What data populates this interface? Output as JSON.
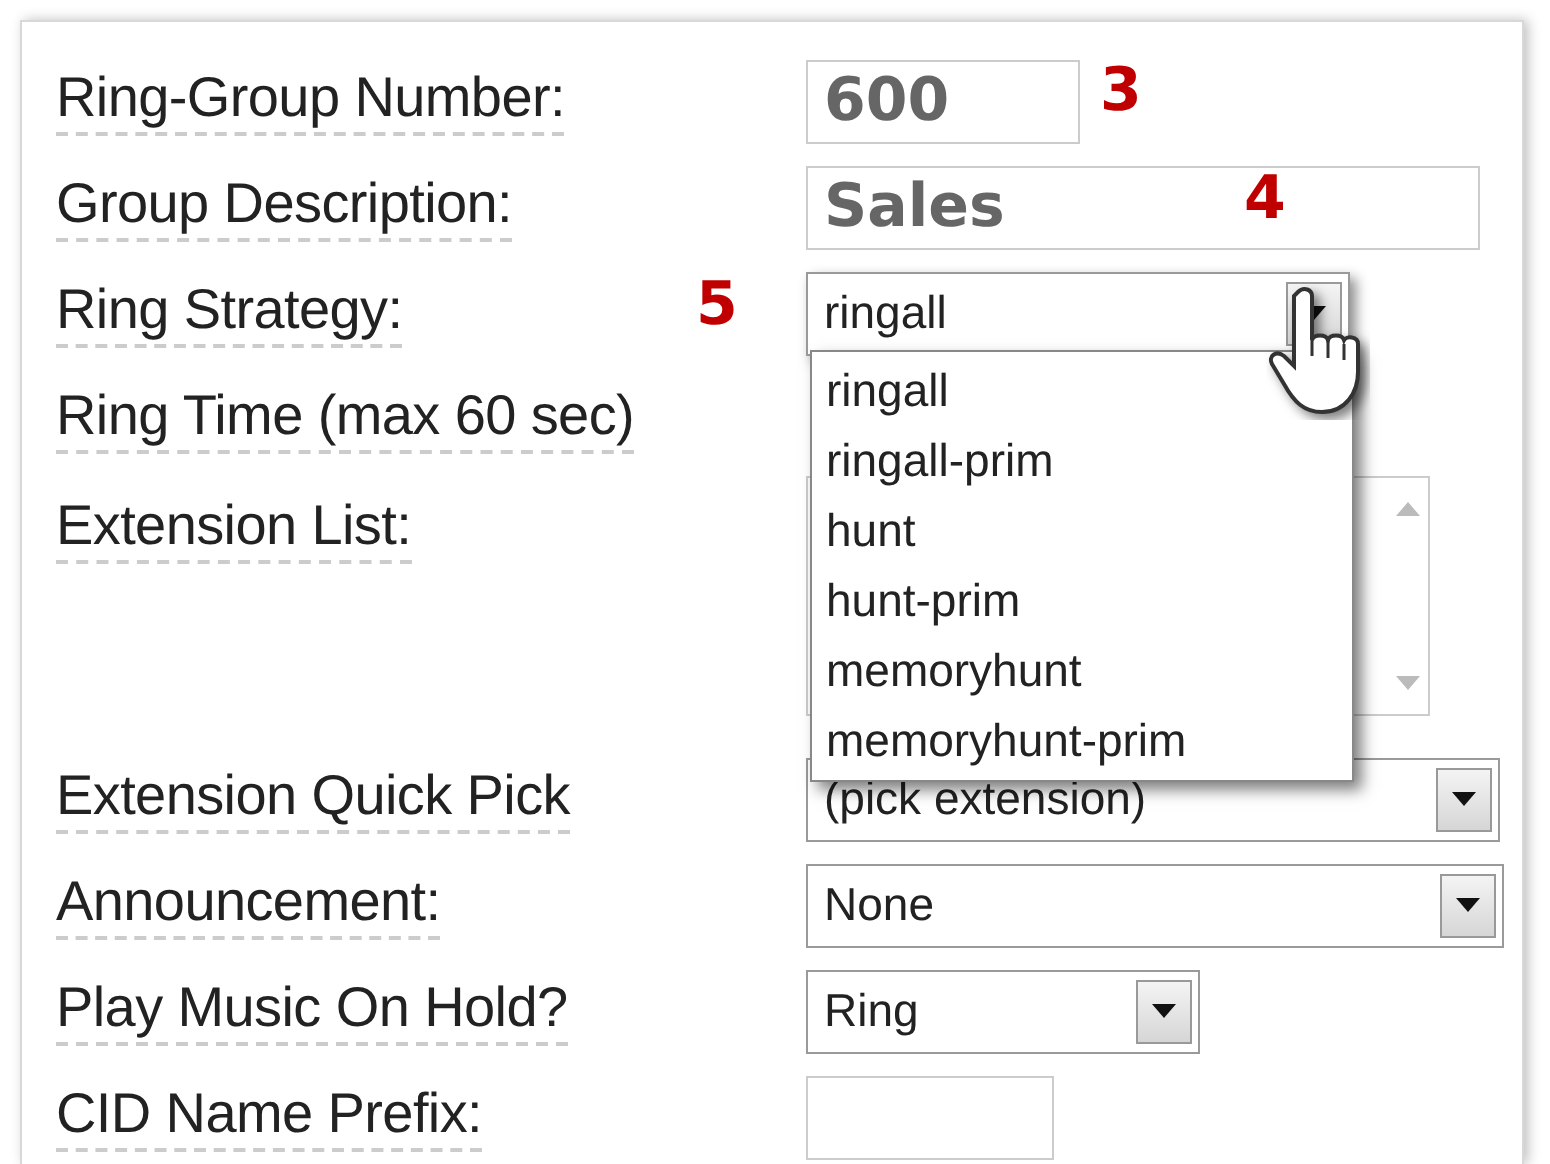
{
  "form": {
    "fields": [
      {
        "kind": "text",
        "label": "Ring-Group Number:",
        "value": "600",
        "annotation": "3"
      },
      {
        "kind": "text",
        "label": "Group Description:",
        "value": "Sales",
        "annotation": "4"
      },
      {
        "kind": "select",
        "label": "Ring Strategy:",
        "value": "ringall",
        "annotation": "5",
        "expanded": true,
        "options": [
          "ringall",
          "ringall-prim",
          "hunt",
          "hunt-prim",
          "memoryhunt",
          "memoryhunt-prim"
        ]
      },
      {
        "kind": "none",
        "label": "Ring Time (max 60 sec)"
      },
      {
        "kind": "textarea",
        "label": "Extension List:"
      },
      {
        "kind": "select",
        "label": "Extension Quick Pick",
        "value": "(pick extension)",
        "expanded": false
      },
      {
        "kind": "select",
        "label": "Announcement:",
        "value": "None",
        "expanded": false
      },
      {
        "kind": "select",
        "label": "Play Music On Hold?",
        "value": "Ring",
        "expanded": false
      },
      {
        "kind": "text",
        "label": "CID Name Prefix:"
      }
    ]
  }
}
